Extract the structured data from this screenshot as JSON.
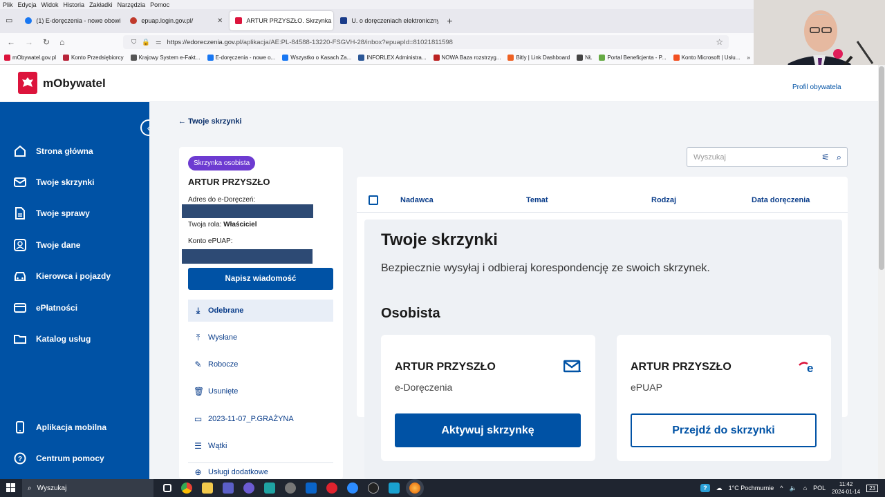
{
  "browser": {
    "menu": [
      "Plik",
      "Edycja",
      "Widok",
      "Historia",
      "Zakładki",
      "Narzędzia",
      "Pomoc"
    ],
    "tabs": [
      {
        "label": "(1) E-doręczenia - nowe obowi",
        "color": "#1877f2"
      },
      {
        "label": "epuap.login.gov.pl/",
        "color": "#c0392b"
      },
      {
        "label": "ARTUR PRZYSZŁO. Skrzynka oso",
        "color": "#dc143c"
      },
      {
        "label": "U. o doręczeniach elektroniczny",
        "color": "#1a3c8a"
      }
    ],
    "new_tab_symbol": "+",
    "url_host": "https://edoreczenia.gov.pl",
    "url_path": "/aplikacja/AE:PL-84588-13220-FSGVH-28/inbox?epuapId=81021811598",
    "bookmarks": [
      {
        "label": "mObywatel.gov.pl",
        "color": "#dc143c"
      },
      {
        "label": "Konto Przedsiębiorcy",
        "color": "#b8253a"
      },
      {
        "label": "Krajowy System e-Fakt...",
        "color": "#555"
      },
      {
        "label": "E-doręczenia - nowe o...",
        "color": "#1877f2"
      },
      {
        "label": "Wszystko o Kasach Za...",
        "color": "#1877f2"
      },
      {
        "label": "INFORLEX Administra...",
        "color": "#2b5797"
      },
      {
        "label": "NOWA Baza rozstrzyg...",
        "color": "#b22"
      },
      {
        "label": "Bitly | Link Dashboard",
        "color": "#ee6123"
      },
      {
        "label": "NŁ",
        "color": "#444"
      },
      {
        "label": "Portal Beneficjenta - P...",
        "color": "#6a4"
      },
      {
        "label": "Konto Microsoft | Usłu...",
        "color": "#f25022"
      }
    ]
  },
  "header": {
    "brand": "mObywatel",
    "profile": "Profil obywatela"
  },
  "sidebar": {
    "items": [
      "Strona główna",
      "Twoje skrzynki",
      "Twoje sprawy",
      "Twoje dane",
      "Kierowca i pojazdy",
      "ePłatności",
      "Katalog usług"
    ],
    "bottom": [
      "Aplikacja mobilna",
      "Centrum pomocy"
    ]
  },
  "breadcrumb": {
    "back": "Twoje skrzynki"
  },
  "panel": {
    "badge": "Skrzynka osobista",
    "owner": "ARTUR PRZYSZŁO",
    "address_label": "Adres do e-Doręczeń:",
    "role_label": "Twoja rola:",
    "role_value": "Właściciel",
    "epuap_label": "Konto ePUAP:",
    "write_button": "Napisz wiadomość",
    "folders": [
      {
        "label": "Odebrane",
        "icon": "⤓"
      },
      {
        "label": "Wysłane",
        "icon": "⤒"
      },
      {
        "label": "Robocze",
        "icon": "✎"
      },
      {
        "label": "Usunięte",
        "icon": "🗑"
      },
      {
        "label": "2023-11-07_P.GRAŻYNA",
        "icon": "▭"
      },
      {
        "label": "Wątki",
        "icon": "☰"
      },
      {
        "label": "Usługi dodatkowe",
        "icon": "⊕"
      }
    ]
  },
  "search": {
    "placeholder": "Wyszukaj"
  },
  "table": {
    "headers": [
      "Nadawca",
      "Temat",
      "Rodzaj",
      "Data doręczenia"
    ]
  },
  "modal": {
    "title": "Twoje skrzynki",
    "subtitle": "Bezpiecznie wysyłaj i odbieraj korespondencję ze swoich skrzynek.",
    "section": "Osobista",
    "cards": [
      {
        "name": "ARTUR PRZYSZŁO",
        "type": "e-Doręczenia",
        "button": "Aktywuj skrzynkę",
        "icon": "envelope-icon"
      },
      {
        "name": "ARTUR PRZYSZŁO",
        "type": "ePUAP",
        "button": "Przejdź do skrzynki",
        "icon": "epuap-logo-icon"
      }
    ]
  },
  "taskbar": {
    "search": "Wyszukaj",
    "weather": "1°C  Pochmurnie",
    "lang": "POL",
    "time": "11:42",
    "date": "2024-01-14",
    "notifications": "23"
  },
  "colors": {
    "primary": "#0052a5",
    "badge": "#6d3bd1",
    "brand_red": "#dc143c"
  }
}
